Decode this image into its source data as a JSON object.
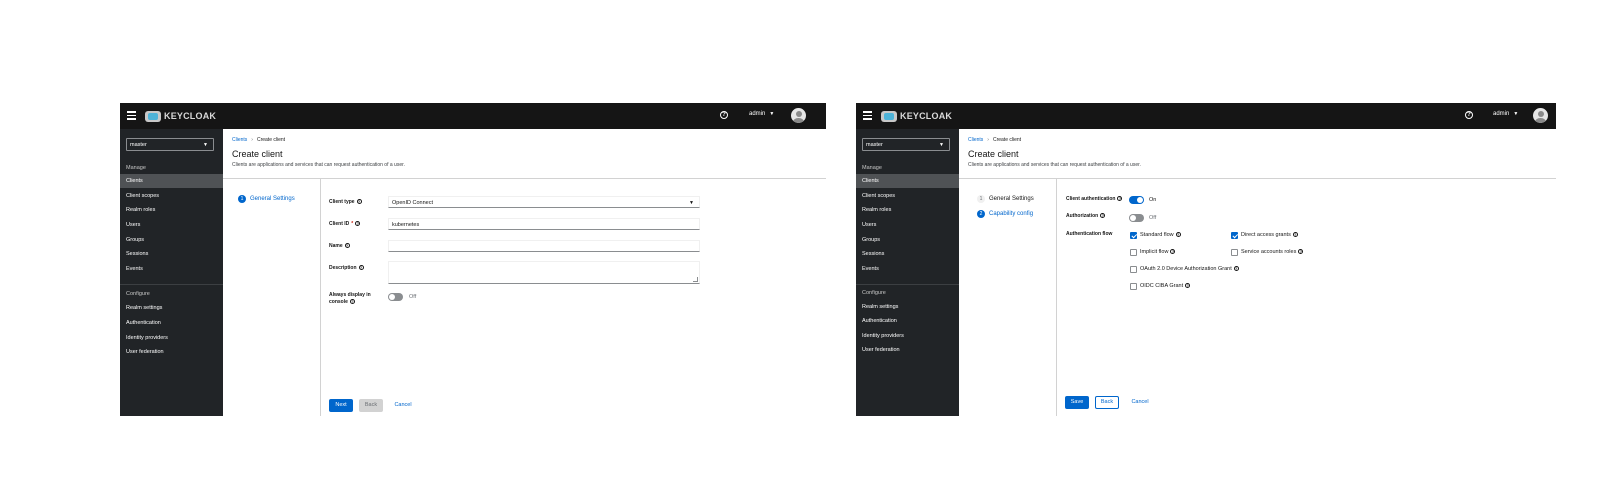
{
  "masthead": {
    "brand": "KEYCLOAK",
    "help_icon": "help-icon",
    "user_name": "admin"
  },
  "sidebar": {
    "realm": "master",
    "manage_group": "Manage",
    "manage_items": [
      "Clients",
      "Client scopes",
      "Realm roles",
      "Users",
      "Groups",
      "Sessions",
      "Events"
    ],
    "configure_group": "Configure",
    "configure_items": [
      "Realm settings",
      "Authentication",
      "Identity providers",
      "User federation"
    ]
  },
  "page": {
    "breadcrumb_link": "Clients",
    "breadcrumb_current": "Create client",
    "title": "Create client",
    "description": "Clients are applications and services that can request authentication of a user."
  },
  "screen1": {
    "steps": [
      {
        "number": "1",
        "label": "General Settings"
      }
    ],
    "form": {
      "client_type_label": "Client type",
      "client_type_value": "OpenID Connect",
      "client_id_label": "Client ID",
      "client_id_required": "*",
      "client_id_value": "kubernetes",
      "name_label": "Name",
      "description_label": "Description",
      "always_display_label_line1": "Always display in",
      "always_display_label_line2": "console",
      "always_display_state": "Off"
    },
    "buttons": {
      "next": "Next",
      "back": "Back",
      "cancel": "Cancel"
    }
  },
  "screen2": {
    "steps": [
      {
        "number": "1",
        "label": "General Settings"
      },
      {
        "number": "2",
        "label": "Capability config"
      }
    ],
    "form": {
      "client_auth_label": "Client authentication",
      "client_auth_state": "On",
      "authorization_label": "Authorization",
      "authorization_state": "Off",
      "auth_flow_label": "Authentication flow",
      "flows": [
        {
          "label": "Standard flow",
          "checked": true
        },
        {
          "label": "Direct access grants",
          "checked": true
        },
        {
          "label": "Implicit flow",
          "checked": false
        },
        {
          "label": "Service accounts roles",
          "checked": false
        },
        {
          "label": "OAuth 2.0 Device Authorization Grant",
          "checked": false
        },
        {
          "label": "OIDC CIBA Grant",
          "checked": false
        }
      ]
    },
    "buttons": {
      "save": "Save",
      "back": "Back",
      "cancel": "Cancel"
    }
  },
  "colors": {
    "masthead": "#151515",
    "sidebar": "#212427",
    "active_nav": "#4f5255",
    "primary": "#0066cc"
  }
}
